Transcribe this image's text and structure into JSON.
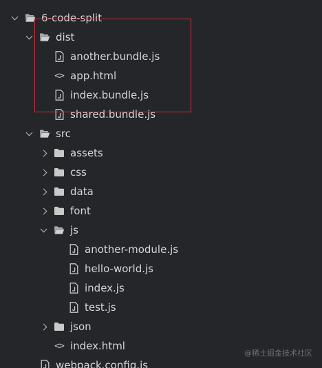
{
  "tree": [
    {
      "label": "6-code-split",
      "type": "folder",
      "state": "open",
      "depth": 0
    },
    {
      "label": "dist",
      "type": "folder",
      "state": "open",
      "depth": 1
    },
    {
      "label": "another.bundle.js",
      "type": "js",
      "depth": 2
    },
    {
      "label": "app.html",
      "type": "html",
      "depth": 2
    },
    {
      "label": "index.bundle.js",
      "type": "js",
      "depth": 2
    },
    {
      "label": "shared.bundle.js",
      "type": "js",
      "depth": 2
    },
    {
      "label": "src",
      "type": "folder",
      "state": "open",
      "depth": 1
    },
    {
      "label": "assets",
      "type": "folder",
      "state": "closed",
      "depth": 2
    },
    {
      "label": "css",
      "type": "folder",
      "state": "closed",
      "depth": 2
    },
    {
      "label": "data",
      "type": "folder",
      "state": "closed",
      "depth": 2
    },
    {
      "label": "font",
      "type": "folder",
      "state": "closed",
      "depth": 2
    },
    {
      "label": "js",
      "type": "folder",
      "state": "open",
      "depth": 2
    },
    {
      "label": "another-module.js",
      "type": "js",
      "depth": 3
    },
    {
      "label": "hello-world.js",
      "type": "js",
      "depth": 3
    },
    {
      "label": "index.js",
      "type": "js",
      "depth": 3
    },
    {
      "label": "test.js",
      "type": "js",
      "depth": 3
    },
    {
      "label": "json",
      "type": "folder",
      "state": "closed",
      "depth": 2
    },
    {
      "label": "index.html",
      "type": "html",
      "depth": 2
    },
    {
      "label": "webpack.config.js",
      "type": "js",
      "depth": 1
    }
  ],
  "highlight_color": "#cc2f3a",
  "icons": {
    "folder-open": "folder-open-icon",
    "folder-closed": "folder-icon",
    "js": "js-file-icon",
    "html": "html-file-icon"
  },
  "watermark": "@稀土掘金技术社区"
}
